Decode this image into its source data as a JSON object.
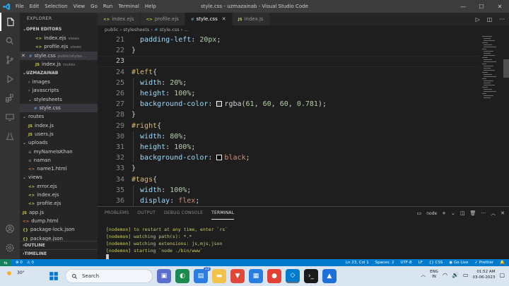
{
  "window": {
    "title": "style.css - uzmazainab - Visual Studio Code",
    "menu": [
      "File",
      "Edit",
      "Selection",
      "View",
      "Go",
      "Run",
      "Terminal",
      "Help"
    ]
  },
  "sidebar": {
    "title": "EXPLORER",
    "open_editors": {
      "label": "OPEN EDITORS",
      "items": [
        {
          "name": "index.ejs",
          "desc": "views",
          "icon": "ejs-icon"
        },
        {
          "name": "profile.ejs",
          "desc": "views",
          "icon": "ejs-icon"
        },
        {
          "name": "style.css",
          "desc": "public\\styles...",
          "icon": "css-icon"
        },
        {
          "name": "index.js",
          "desc": "routes",
          "icon": "js-icon"
        }
      ]
    },
    "project": {
      "label": "UZMAZAINAB",
      "tree": [
        {
          "name": "images",
          "type": "folder"
        },
        {
          "name": "javascripts",
          "type": "folder"
        },
        {
          "name": "stylesheets",
          "type": "folder"
        },
        {
          "name": "style.css",
          "type": "css"
        },
        {
          "name": "routes",
          "type": "folder"
        },
        {
          "name": "index.js",
          "type": "js"
        },
        {
          "name": "users.js",
          "type": "js"
        },
        {
          "name": "uploads",
          "type": "folder"
        },
        {
          "name": "myNameIsKhan",
          "type": "plain"
        },
        {
          "name": "naman",
          "type": "plain"
        },
        {
          "name": "name1.html",
          "type": "html"
        },
        {
          "name": "views",
          "type": "folder"
        },
        {
          "name": "error.ejs",
          "type": "ejs"
        },
        {
          "name": "index.ejs",
          "type": "ejs"
        },
        {
          "name": "profile.ejs",
          "type": "ejs"
        },
        {
          "name": "app.js",
          "type": "js"
        },
        {
          "name": "dump.html",
          "type": "html"
        },
        {
          "name": "package-lock.json",
          "type": "json"
        },
        {
          "name": "package.json",
          "type": "json"
        }
      ]
    },
    "outline": "OUTLINE",
    "timeline": "TIMELINE"
  },
  "tabs": [
    {
      "label": "index.ejs",
      "icon": "ejs-icon",
      "active": false
    },
    {
      "label": "profile.ejs",
      "icon": "ejs-icon",
      "active": false
    },
    {
      "label": "style.css",
      "icon": "css-icon",
      "active": true
    },
    {
      "label": "index.js",
      "icon": "js-icon",
      "active": false
    }
  ],
  "breadcrumb": [
    "public",
    "stylesheets",
    "style.css",
    "..."
  ],
  "editor": {
    "current_line": 23,
    "lines": [
      {
        "n": 21,
        "text": "  padding-left: 20px;"
      },
      {
        "n": 22,
        "text": "}"
      },
      {
        "n": 23,
        "text": ""
      },
      {
        "n": 24,
        "text": "#left{"
      },
      {
        "n": 25,
        "text": "  width: 20%;"
      },
      {
        "n": 26,
        "text": "  height: 100%;"
      },
      {
        "n": 27,
        "text": "  background-color: rgba(61, 60, 60, 0.781);"
      },
      {
        "n": 28,
        "text": "}"
      },
      {
        "n": 29,
        "text": "#right{"
      },
      {
        "n": 30,
        "text": "  width: 80%;"
      },
      {
        "n": 31,
        "text": "  height: 100%;"
      },
      {
        "n": 32,
        "text": "  background-color: black;"
      },
      {
        "n": 33,
        "text": "}"
      },
      {
        "n": 34,
        "text": "#tags{"
      },
      {
        "n": 35,
        "text": "  width: 100%;"
      },
      {
        "n": 36,
        "text": "  display: flex;"
      }
    ]
  },
  "panel": {
    "tabs": [
      "PROBLEMS",
      "OUTPUT",
      "DEBUG CONSOLE",
      "TERMINAL"
    ],
    "active_tab": "TERMINAL",
    "terminal_name": "node",
    "terminal_lines": [
      "[nodemon] to restart at any time, enter `rs`",
      "[nodemon] watching path(s): *.*",
      "[nodemon] watching extensions: js,mjs,json",
      "[nodemon] starting `node ./bin/www`"
    ]
  },
  "statusbar": {
    "errors": "⊗ 0",
    "warnings": "⚠ 0",
    "position": "Ln 23, Col 1",
    "spaces": "Spaces: 2",
    "encoding": "UTF-8",
    "eol": "LF",
    "language": "CSS",
    "golive": "Go Live",
    "prettier": "Prettier"
  },
  "taskbar": {
    "temperature": "30°",
    "search_placeholder": "Search",
    "lang_top": "ENG",
    "lang_bottom": "IN",
    "time": "01:52 AM",
    "date": "03-06-2023",
    "badge": "13"
  },
  "colors": {
    "accent": "#007acc",
    "rgba_swatch": "rgba(61, 60, 60, 0.781)",
    "black_swatch": "#000000"
  }
}
